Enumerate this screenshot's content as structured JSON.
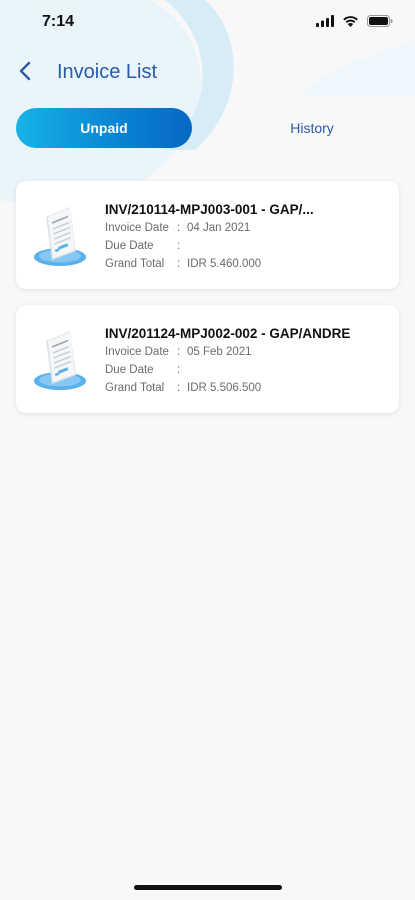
{
  "status_bar": {
    "time": "7:14"
  },
  "header": {
    "title": "Invoice List"
  },
  "tabs": [
    {
      "label": "Unpaid",
      "active": true
    },
    {
      "label": "History",
      "active": false
    }
  ],
  "invoices": [
    {
      "title": "INV/210114-MPJ003-001 - GAP/...",
      "invoice_date_label": "Invoice Date",
      "invoice_date": "04 Jan 2021",
      "due_date_label": "Due Date",
      "due_date": "",
      "grand_total_label": "Grand Total",
      "grand_total": "IDR 5.460.000"
    },
    {
      "title": "INV/201124-MPJ002-002 - GAP/ANDRE",
      "invoice_date_label": "Invoice Date",
      "invoice_date": "05 Feb 2021",
      "due_date_label": "Due Date",
      "due_date": "",
      "grand_total_label": "Grand Total",
      "grand_total": "IDR 5.506.500"
    }
  ],
  "colors": {
    "accent": "#2b5aa6",
    "tab_gradient_start": "#16b3e8",
    "tab_gradient_end": "#0668c2",
    "background": "#f8f8f9"
  }
}
